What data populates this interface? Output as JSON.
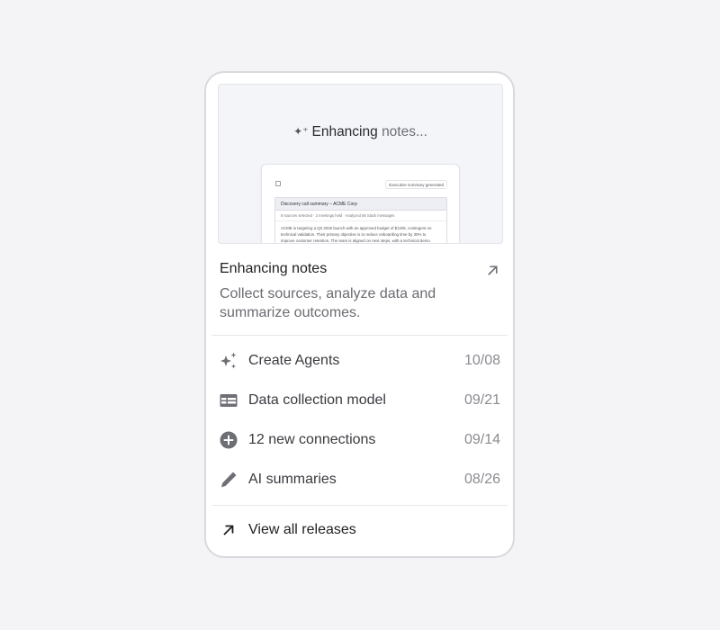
{
  "preview": {
    "status_main": "Enhancing",
    "status_dim": "notes...",
    "doc_badge": "Executive summary generated",
    "doc_heading": "Discovery call summary – ACME Corp",
    "doc_meta": "8 sources selected · 2 meetings held · Analyzed 56 Slack messages",
    "doc_body_1": "ACME is targeting a Q3 2025 launch with an approved budget of $120k, contingent on",
    "doc_body_2": "technical validation. Their primary objective is to reduce onboarding time by 30% to",
    "doc_body_3": "improve customer retention. The team is aligned on next steps, with a technical demo"
  },
  "card": {
    "title": "Enhancing notes",
    "description": "Collect sources, analyze data and summarize outcomes."
  },
  "releases": [
    {
      "icon": "sparkles-icon",
      "label": "Create Agents",
      "date": "10/08"
    },
    {
      "icon": "table-icon",
      "label": "Data collection model",
      "date": "09/21"
    },
    {
      "icon": "plus-circle-icon",
      "label": "12 new connections",
      "date": "09/14"
    },
    {
      "icon": "pencil-icon",
      "label": "AI summaries",
      "date": "08/26"
    }
  ],
  "footer": {
    "label": "View all releases"
  },
  "colors": {
    "icon": "#6e6e75",
    "border": "#d9d9de",
    "background": "#f4f4f6"
  }
}
